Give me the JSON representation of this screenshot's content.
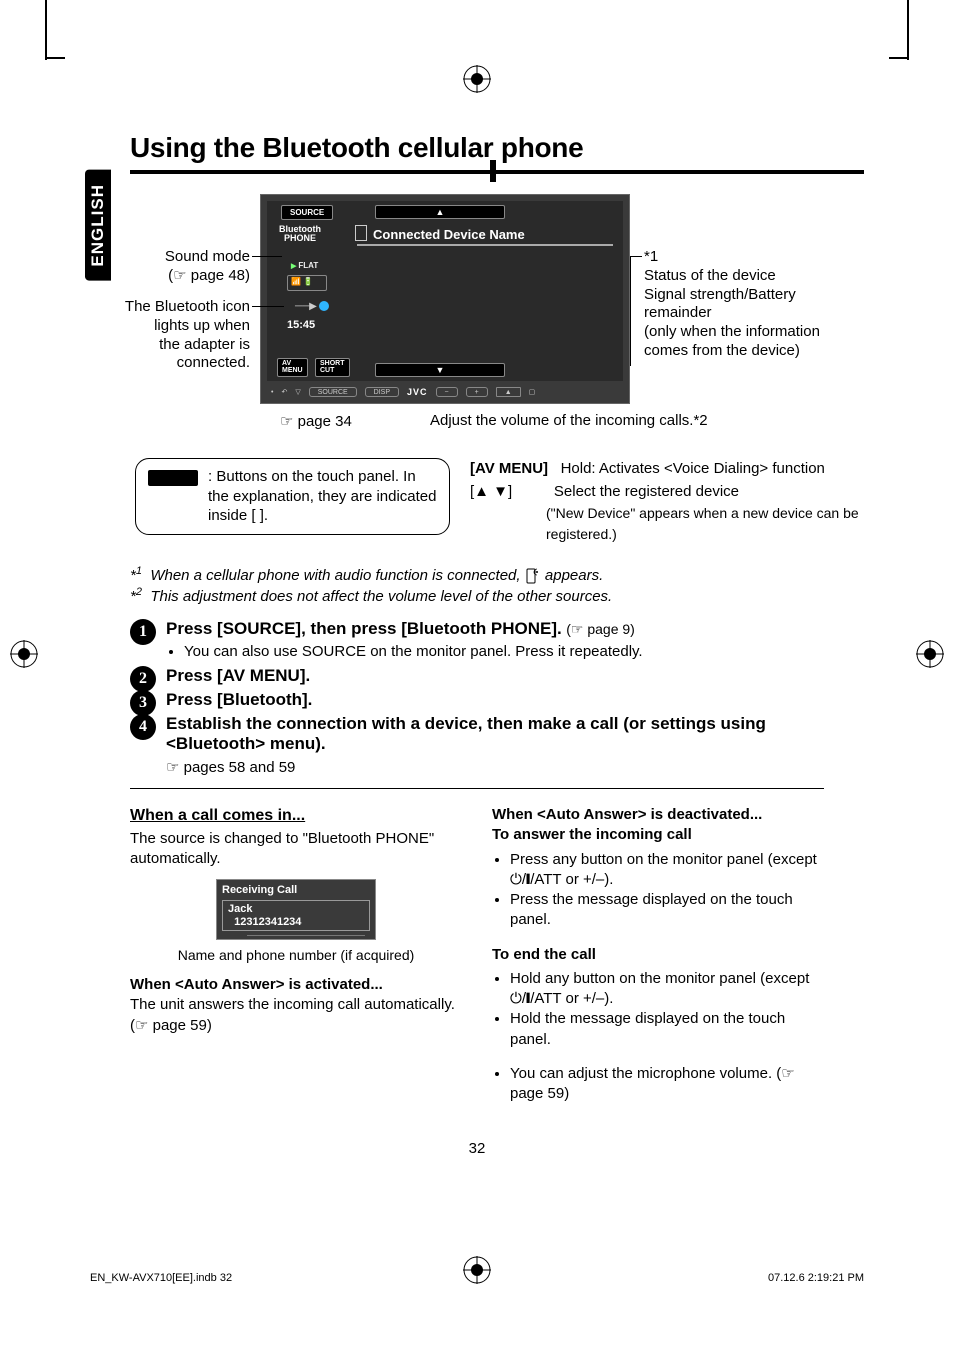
{
  "meta": {
    "language_tab": "ENGLISH",
    "page_number": "32"
  },
  "title": "Using the Bluetooth cellular phone",
  "buttons": {
    "source": "SOURCE",
    "source_line1": "Bluetooth",
    "source_line2": "PHONE",
    "connected_name": "Connected Device Name",
    "flat": "FLAT",
    "clock": "15:45",
    "av_menu": "AV\nMENU",
    "short_cut": "SHORT\nCUT",
    "jvc": "JVC"
  },
  "labels": {
    "left1_line1": "Sound mode",
    "left1_line2": "(☞ page 48)",
    "left2_line1": "The Bluetooth icon",
    "left2_line2": "lights up when",
    "left2_line3": "the adapter is",
    "left2_line4": "connected.",
    "right1_line1": "*1",
    "right1_line2": "Status of the device",
    "right1_line3": "Signal strength/Battery",
    "right1_line4": "remainder",
    "right1_line5": "(only when the information",
    "right1_line6": "comes from the device)",
    "below1": "☞ page 34",
    "below2": "Adjust the volume of the incoming calls.*2"
  },
  "legend": {
    "text": "Buttons on the touch panel. In the explanation, they are indicated inside [     ].",
    "r1_label": "[AV MENU]",
    "r1_text": "Hold: Activates <Voice Dialing> function",
    "r2_label": "[▲ ▼]",
    "r2_text": "Select the registered device",
    "r2_sub": "(\"New Device\" appears when a new device can be registered.)"
  },
  "footnotes": {
    "f1_pre": "When a cellular phone with audio function is connected, ",
    "f1_post": " appears.",
    "f2": "This adjustment does not affect the volume level of the other sources."
  },
  "steps": {
    "s1_title": "Press [SOURCE], then press [Bluetooth PHONE].",
    "s1_ref": "(☞ page 9)",
    "s1_bullet": "You can also use SOURCE on the monitor panel. Press it repeatedly.",
    "s2_title": "Press [AV MENU].",
    "s3_title": "Press [Bluetooth].",
    "s4_title": "Establish the connection with a device, then make a call (or settings using <Bluetooth> menu).",
    "s4_sub": "☞ pages 58 and 59"
  },
  "left_col": {
    "h": "When a call comes in...",
    "p1": "The source is changed to \"Bluetooth PHONE\" automatically.",
    "rc_title": "Receiving Call",
    "rc_name": "Jack",
    "rc_num": "12312341234",
    "caption": "Name and phone number (if acquired)",
    "sub1_title": "When <Auto Answer> is activated...",
    "sub1_text": "The unit answers the incoming call automatically. (☞ page 59)"
  },
  "right_col": {
    "sub1_title": "When <Auto Answer> is deactivated...",
    "sub1_h": "To answer the incoming call",
    "b1a": "Press any button on the monitor panel (except ",
    "b1b": "/ATT or +/–).",
    "b2": "Press the message displayed on the touch panel.",
    "sub2_h": "To end the call",
    "b3a": "Hold any button on the monitor panel (except ",
    "b3b": "/ATT or +/–).",
    "b4": "Hold the message displayed on the touch panel.",
    "b5": "You can adjust the microphone volume. (☞ page 59)"
  },
  "footer": {
    "left": "EN_KW-AVX710[EE].indb   32",
    "right": "07.12.6   2:19:21 PM"
  }
}
